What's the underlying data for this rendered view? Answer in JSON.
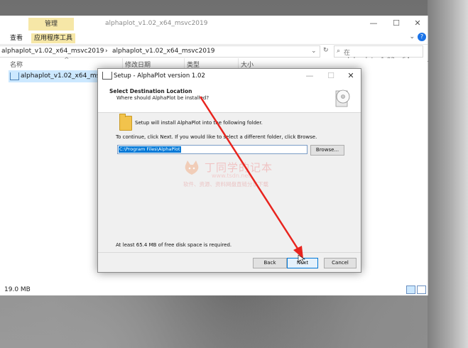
{
  "explorer": {
    "ribbon_title": "alphaplot_v1.02_x64_msvc2019",
    "contextual_tab": "管理",
    "tabs": [
      "查看",
      "应用程序工具"
    ],
    "window_controls": [
      "—",
      "☐",
      "✕"
    ],
    "collapse_glyph": "⌄",
    "help_glyph": "?",
    "address": [
      "alphaplot_v1.02_x64_msvc2019",
      "alphaplot_v1.02_x64_msvc2019"
    ],
    "address_sep": "›",
    "search_placeholder": "在 alphaplot_v1.02_x64_ms...",
    "columns": [
      "名称",
      "修改日期",
      "类型",
      "大小"
    ],
    "file_name": "alphaplot_v1.02_x64_msvc2019",
    "status_size": "19.0 MB"
  },
  "dialog": {
    "title": "Setup - AlphaPlot version 1.02",
    "controls": [
      "—",
      "☐",
      "✕"
    ],
    "header_title": "Select Destination Location",
    "header_subtitle": "Where should AlphaPlot be installed?",
    "install_text": "Setup will install AlphaPlot into the following folder.",
    "continue_text": "To continue, click Next. If you would like to select a different folder, click Browse.",
    "path_value": "C:\\Program Files\\AlphaPlot",
    "browse_label": "Browse...",
    "disk_space_text": "At least 65.4 MB of free disk space is required.",
    "back_label": "Back",
    "next_label": "Next",
    "cancel_label": "Cancel"
  },
  "watermark": {
    "title": "丁同学的记本",
    "url": "www.tsdn.net",
    "subtitle": "软件、资源、资料网盘直链分享下载"
  },
  "colors": {
    "annotation_arrow": "#e8241e",
    "selection": "#0078d7",
    "contextual_tab": "#f6e7a7"
  }
}
